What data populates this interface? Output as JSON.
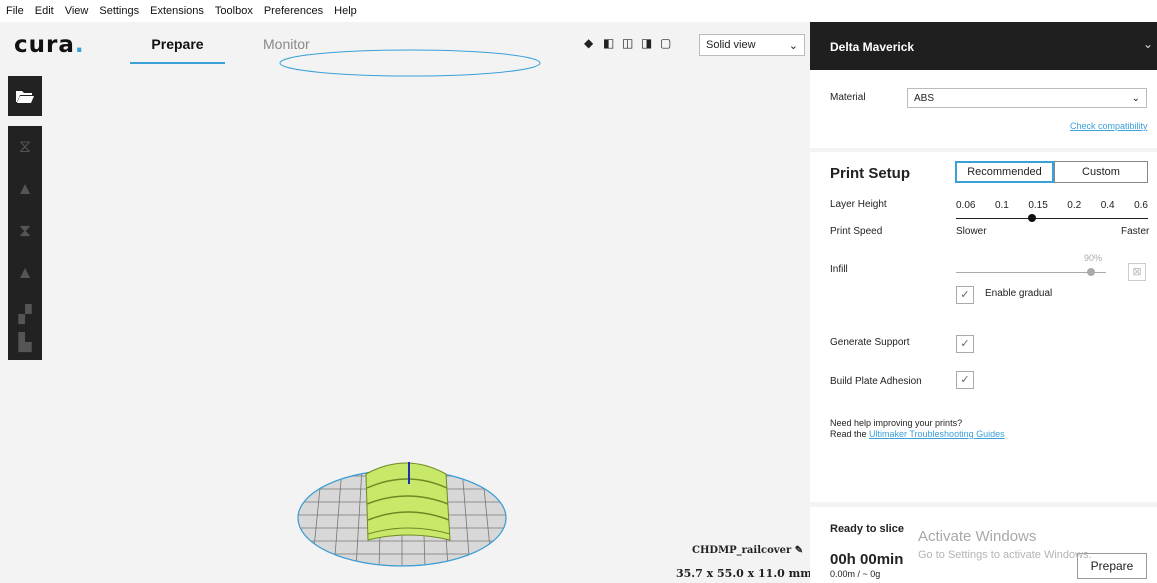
{
  "menu": [
    "File",
    "Edit",
    "View",
    "Settings",
    "Extensions",
    "Toolbox",
    "Preferences",
    "Help"
  ],
  "logo": {
    "text": "cura",
    "dot": "."
  },
  "tabs": {
    "prepare": "Prepare",
    "monitor": "Monitor"
  },
  "view_mode": {
    "selected": "Solid view",
    "chevron": "⌄"
  },
  "printer": {
    "name": "Delta Maverick",
    "chevron": "⌄"
  },
  "material": {
    "label": "Material",
    "value": "ABS",
    "check_link": "Check compatibility"
  },
  "print_setup": {
    "title": "Print Setup",
    "recommended": "Recommended",
    "custom": "Custom",
    "layer_height_label": "Layer Height",
    "layer_heights": [
      "0.06",
      "0.1",
      "0.15",
      "0.2",
      "0.4",
      "0.6"
    ],
    "layer_height_selected": "0.15",
    "print_speed_label": "Print Speed",
    "slower": "Slower",
    "faster": "Faster",
    "infill_label": "Infill",
    "infill_percent": "90%",
    "infill_value": 0.9,
    "enable_gradual": "Enable gradual",
    "generate_support": "Generate Support",
    "build_plate_adhesion": "Build Plate Adhesion",
    "help_line1": "Need help improving your prints?",
    "help_line2_prefix": "Read the ",
    "help_link": "Ultimaker Troubleshooting Guides"
  },
  "slice": {
    "ready": "Ready to slice",
    "time": "00h 00min",
    "usage": "0.00m / ~ 0g",
    "prepare_button": "Prepare"
  },
  "model": {
    "name": "CHDMP_railcover",
    "dimensions": "35.7 x 55.0 x 11.0 mm"
  },
  "watermark": {
    "line1": "Activate Windows",
    "line2": "Go to Settings to activate Windows."
  },
  "colors": {
    "accent": "#3aa0d8",
    "model": "#c8e86a",
    "dark": "#1f1f1f"
  }
}
